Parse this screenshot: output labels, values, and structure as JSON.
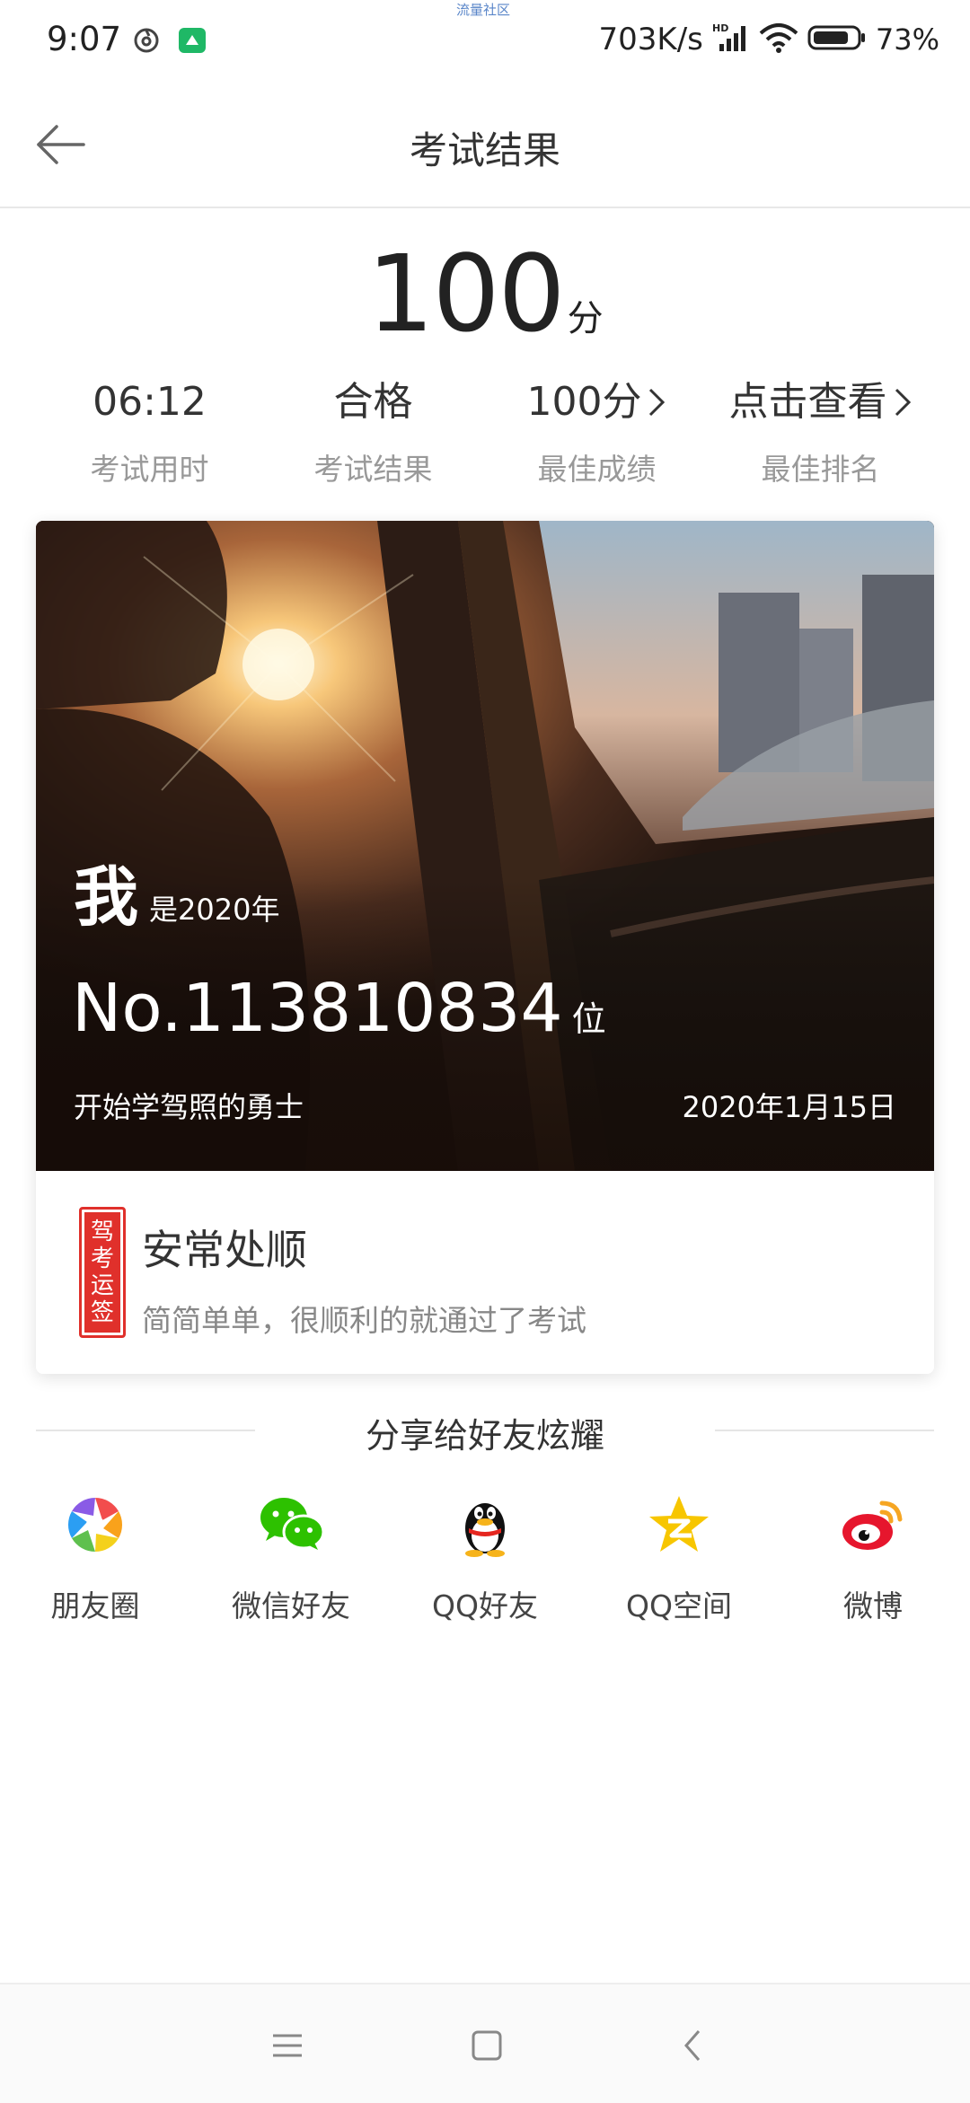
{
  "status_bar": {
    "time": "9:07",
    "carrier_label": "流量社区",
    "network_speed": "703K/s",
    "battery_percent": "73%",
    "icons": [
      "netease-music-icon",
      "app-notification-icon",
      "hd-signal-icon",
      "wifi-icon",
      "battery-icon"
    ]
  },
  "header": {
    "title": "考试结果",
    "back_icon": "arrow-left-icon"
  },
  "score": {
    "value": "100",
    "unit": "分"
  },
  "stats": [
    {
      "value": "06:12",
      "label": "考试用时",
      "has_chevron": false
    },
    {
      "value": "合格",
      "label": "考试结果",
      "has_chevron": false
    },
    {
      "value": "100分",
      "label": "最佳成绩",
      "has_chevron": true
    },
    {
      "value": "点击查看",
      "label": "最佳排名",
      "has_chevron": true
    }
  ],
  "card": {
    "me": "我",
    "year_text": "是2020年",
    "rank": "No.113810834",
    "rank_unit": "位",
    "caption": "开始学驾照的勇士",
    "date": "2020年1月15日",
    "stamp": [
      "驾",
      "考",
      "运",
      "签"
    ],
    "fortune_title": "安常处顺",
    "fortune_desc": "简简单单，很顺利的就通过了考试"
  },
  "share": {
    "heading": "分享给好友炫耀",
    "items": [
      {
        "label": "朋友圈",
        "icon": "moments-icon"
      },
      {
        "label": "微信好友",
        "icon": "wechat-icon"
      },
      {
        "label": "QQ好友",
        "icon": "qq-icon"
      },
      {
        "label": "QQ空间",
        "icon": "qzone-icon"
      },
      {
        "label": "微博",
        "icon": "weibo-icon"
      }
    ]
  },
  "colors": {
    "stamp_red": "#e0302b",
    "wechat_green": "#2dc100",
    "weibo_red": "#e6162d",
    "qzone_yellow": "#f7c600"
  }
}
